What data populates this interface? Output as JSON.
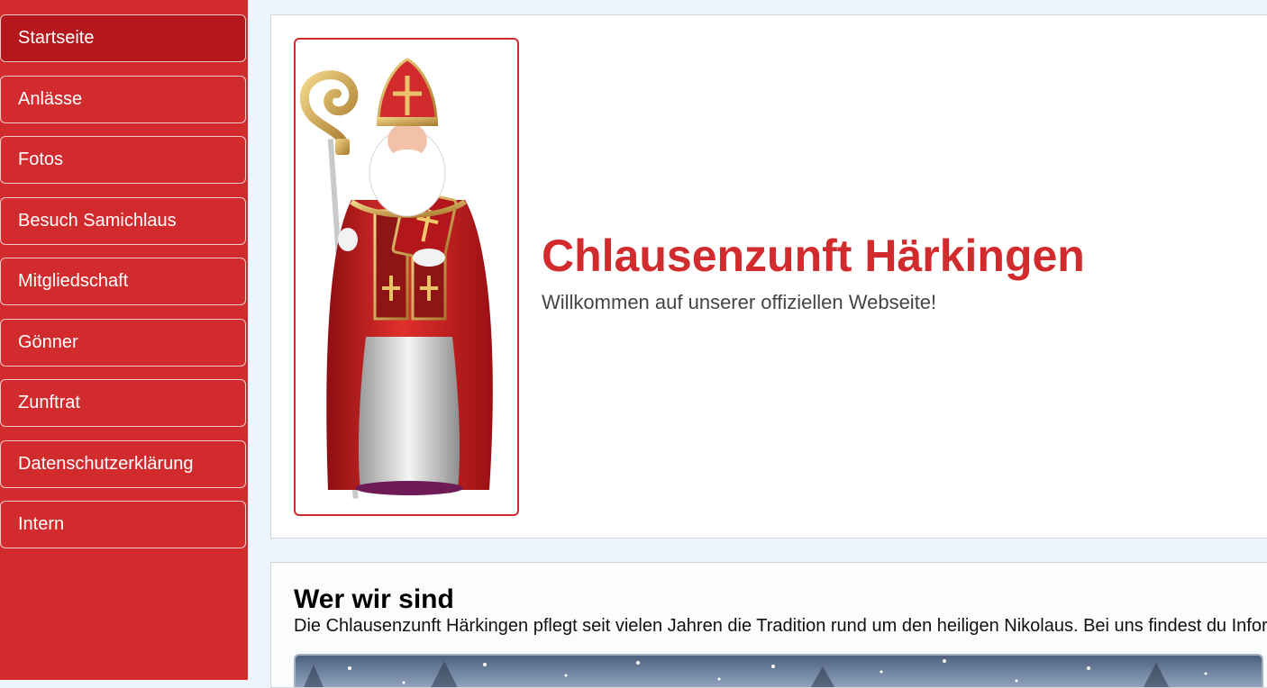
{
  "sidebar": {
    "items": [
      {
        "label": "Startseite",
        "active": true
      },
      {
        "label": "Anlässe"
      },
      {
        "label": "Fotos"
      },
      {
        "label": "Besuch Samichlaus"
      },
      {
        "label": "Mitgliedschaft"
      },
      {
        "label": "Gönner"
      },
      {
        "label": "Zunftrat"
      },
      {
        "label": "Datenschutzerklärung"
      },
      {
        "label": "Intern"
      }
    ]
  },
  "hero": {
    "title": "Chlausenzunft Härkingen",
    "subtitle": "Willkommen auf unserer offiziellen Webseite!",
    "image": "saint-nicholas-illustration"
  },
  "about": {
    "heading": "Wer wir sind",
    "text": "Die Chlausenzunft Härkingen pflegt seit vielen Jahren die Tradition rund um den heiligen Nikolaus. Bei uns findest du Infor",
    "image": "winter-forest-photo"
  },
  "colors": {
    "brand_red": "#d22b2e",
    "active_red": "#b5181c",
    "background": "#eef4fb"
  }
}
